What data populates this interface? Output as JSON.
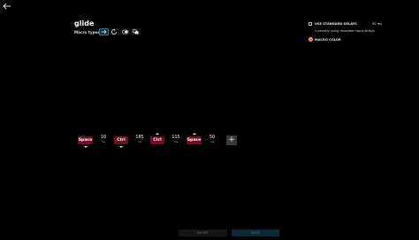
{
  "header": {
    "back_icon": "arrow-left-icon"
  },
  "macro": {
    "name": "glide",
    "types_label": "Macro types",
    "types": [
      {
        "icon": "arrow-right-icon",
        "selected": true
      },
      {
        "icon": "repeat-icon",
        "selected": false
      },
      {
        "icon": "toggle-icon",
        "selected": false
      },
      {
        "icon": "sequence-icon",
        "selected": false
      }
    ]
  },
  "settings": {
    "standard_delays_label": "USE STANDARD DELAYS",
    "standard_delays_value": "50 ms",
    "recorded_delays_text": "Currently using recorded input delays",
    "macro_color_label": "MACRO COLOR",
    "macro_color": "#e06a4a"
  },
  "sequence": {
    "keys": [
      "Space",
      "Ctrl",
      "Ctrl",
      "Space"
    ],
    "delays": [
      {
        "value": "10",
        "unit": "ms"
      },
      {
        "value": "185",
        "unit": "ms"
      },
      {
        "value": "115",
        "unit": "ms"
      },
      {
        "value": "50",
        "unit": "ms"
      }
    ],
    "add_symbol": "+"
  },
  "footer": {
    "reset_label": "RESET",
    "save_label": "SAVE"
  }
}
